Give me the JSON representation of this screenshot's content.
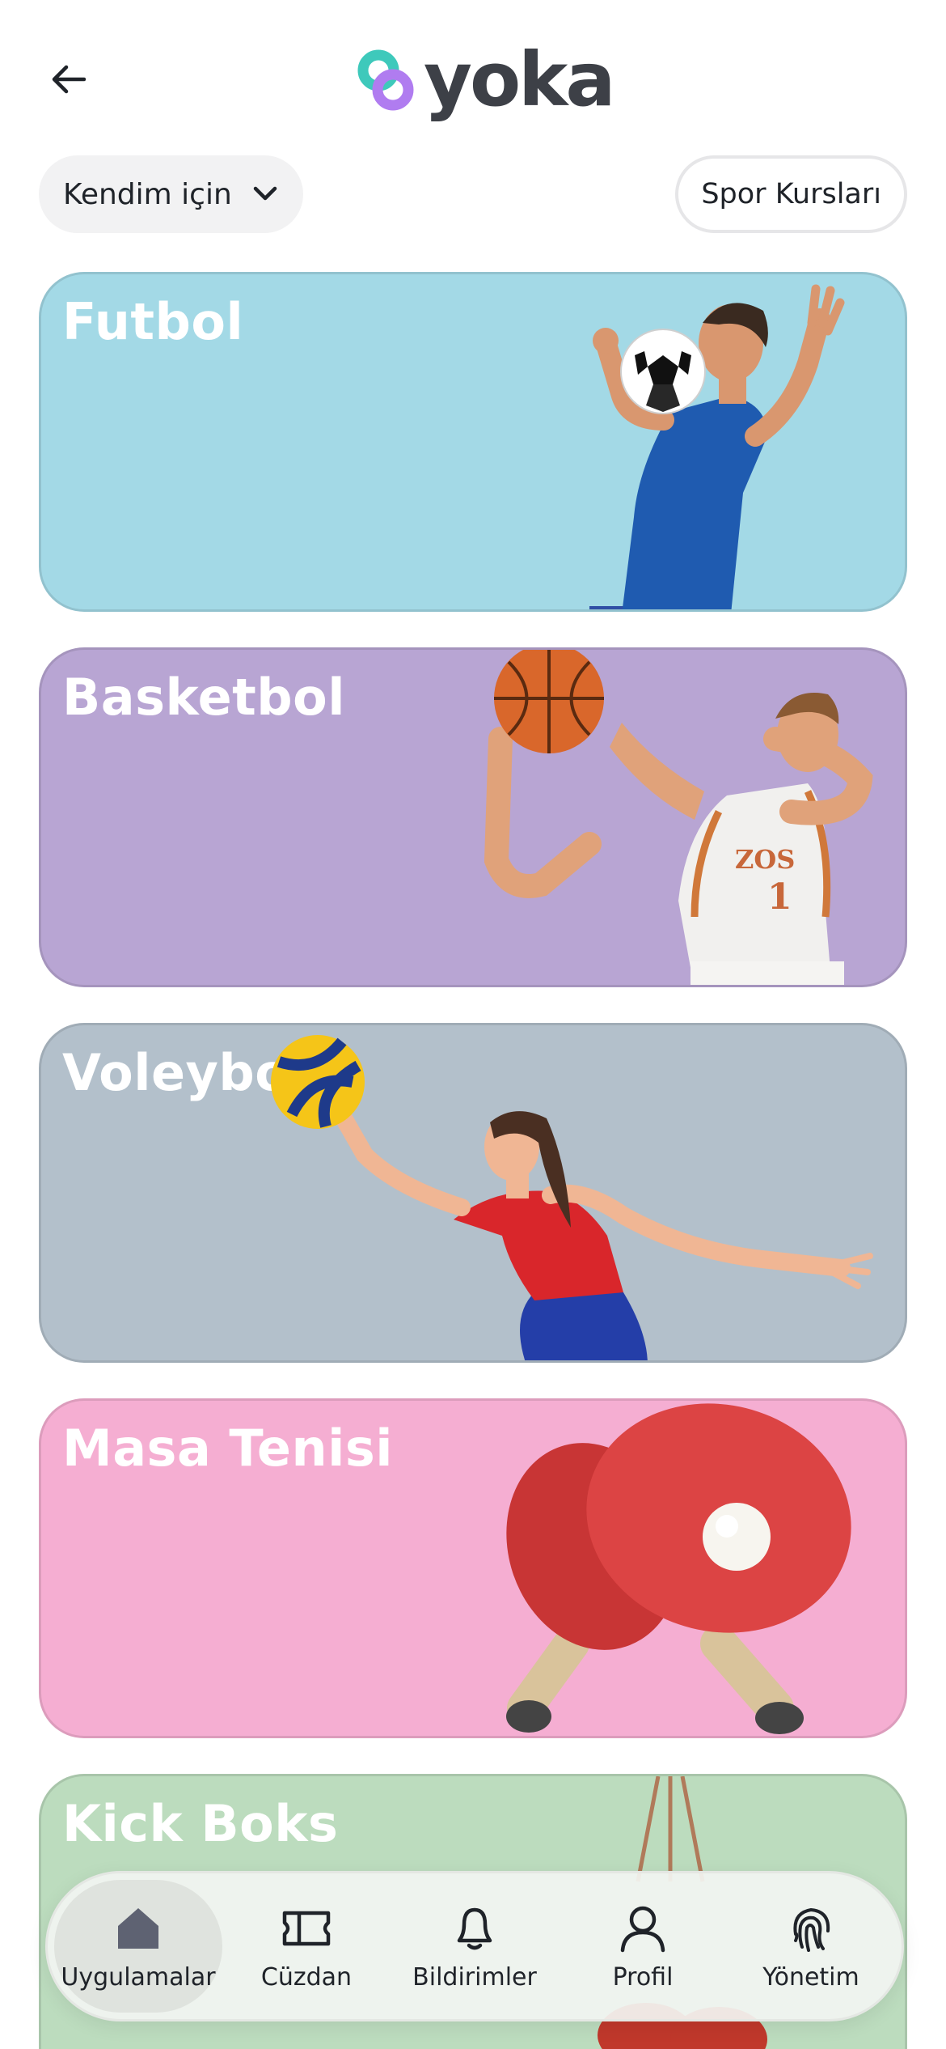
{
  "header": {
    "back_icon": "arrow-left-icon",
    "logo_text": "yoka",
    "logo_colors": {
      "teal": "#3ec9bb",
      "purple": "#b07cf0",
      "text": "#3d4047"
    }
  },
  "filters": {
    "audience_value": "Kendim için",
    "category_chip": "Spor Kursları"
  },
  "cards": [
    {
      "title": "Futbol",
      "color": "#a3d9e6",
      "art": "soccer-player-image"
    },
    {
      "title": "Basketbol",
      "color": "#b8a5d3",
      "art": "basketball-player-image"
    },
    {
      "title": "Voleybol",
      "color": "#b3c0cb",
      "art": "volleyball-player-image"
    },
    {
      "title": "Masa Tenisi",
      "color": "#f5aed2",
      "art": "table-tennis-paddles-image"
    },
    {
      "title": "Kick Boks",
      "color": "#bcdcbe",
      "art": "boxing-bag-image"
    }
  ],
  "nav": {
    "items": [
      {
        "label": "Uygulamalar",
        "icon": "home-icon",
        "active": true
      },
      {
        "label": "Cüzdan",
        "icon": "ticket-icon",
        "active": false
      },
      {
        "label": "Bildirimler",
        "icon": "bell-icon",
        "active": false
      },
      {
        "label": "Profil",
        "icon": "user-icon",
        "active": false
      },
      {
        "label": "Yönetim",
        "icon": "fingerprint-icon",
        "active": false
      }
    ]
  }
}
